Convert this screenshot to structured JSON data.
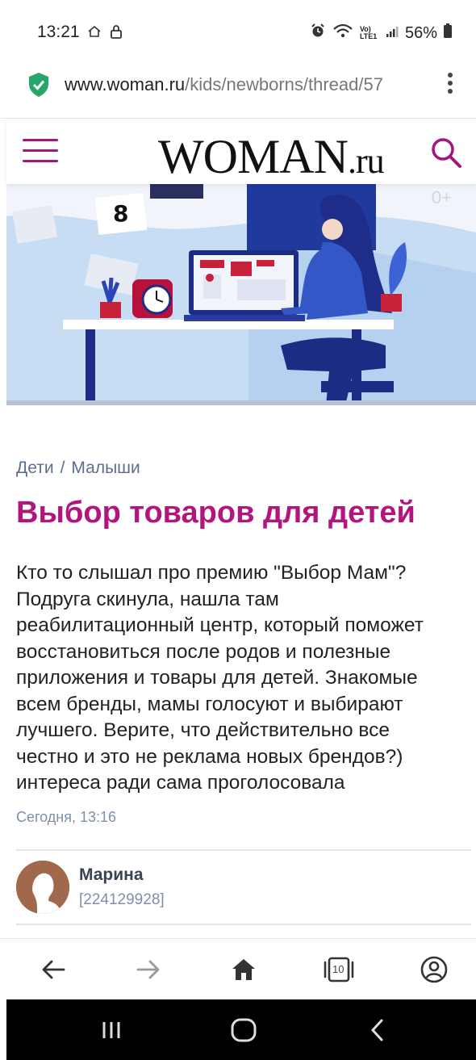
{
  "status": {
    "time": "13:21",
    "battery": "56%",
    "network_label": "Vo) LTE1"
  },
  "browser": {
    "url_host": "www.woman.ru",
    "url_path": "/kids/newborns/thread/57",
    "tab_count": "10"
  },
  "site": {
    "logo_main": "WOMAN",
    "logo_suffix": ".ru",
    "brand_color": "#b3157f"
  },
  "hero": {
    "calendar_number": "8",
    "age_rating": "0+"
  },
  "article": {
    "breadcrumb": [
      {
        "label": "Дети"
      },
      {
        "label": "Малыши"
      }
    ],
    "breadcrumb_separator": "/",
    "title": "Выбор товаров для детей",
    "body_lines": [
      "Кто то слышал про премию \"Выбор Мам\"?",
      "Подруга скинула, нашла там",
      "реабилитационный центр, который поможет",
      "восстановиться после родов и полезные",
      "приложения и товары для детей. Знакомые",
      "всем бренды, мамы голосуют и выбирают",
      "лучшего. Верите, что действительно все",
      "честно и это не реклама новых брендов?)",
      "интереса ради сама проголосовала"
    ],
    "date": "Сегодня, 13:16"
  },
  "author": {
    "name": "Марина",
    "id": "[224129928]"
  },
  "icons": {
    "back": "arrow-left-icon",
    "forward": "arrow-right-icon",
    "home": "home-icon",
    "tabs": "tabs-icon",
    "profile": "profile-icon"
  }
}
